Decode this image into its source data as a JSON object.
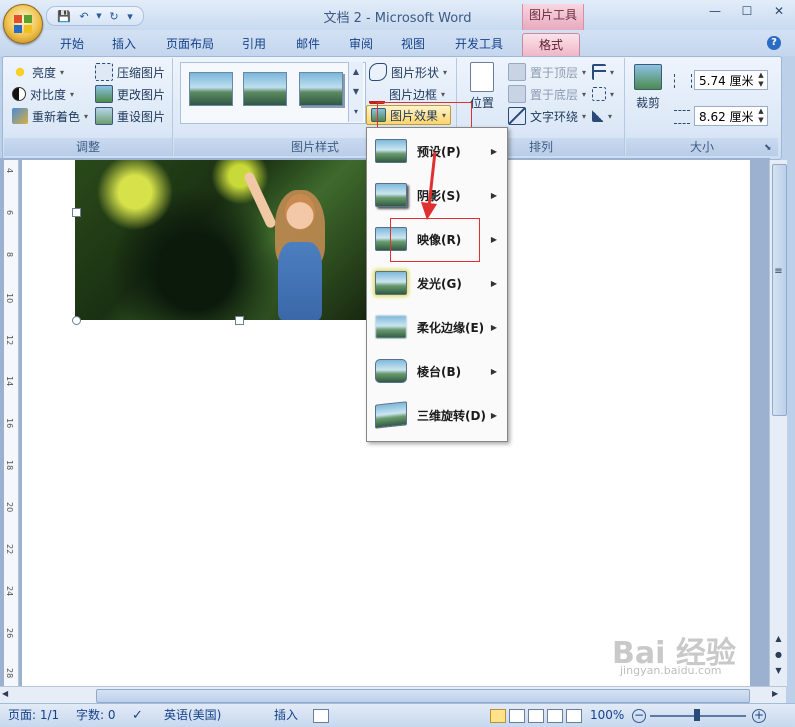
{
  "window": {
    "doc_title": "文档 2 - Microsoft Word",
    "context_tab_title": "图片工具",
    "controls": [
      "—",
      "☐",
      "✕"
    ]
  },
  "tabs": [
    "开始",
    "插入",
    "页面布局",
    "引用",
    "邮件",
    "审阅",
    "视图",
    "开发工具",
    "格式"
  ],
  "active_tab": "格式",
  "ribbon": {
    "adjust": {
      "label": "调整",
      "brightness": "亮度",
      "contrast": "对比度",
      "recolor": "重新着色",
      "compress": "压缩图片",
      "change": "更改图片",
      "reset": "重设图片"
    },
    "styles": {
      "label": "图片样式",
      "shape": "图片形状",
      "border": "图片边框",
      "effects": "图片效果"
    },
    "arrange": {
      "label": "排列",
      "position": "位置",
      "bring_front": "置于顶层",
      "send_back": "置于底层",
      "wrap": "文字环绕"
    },
    "size": {
      "label": "大小",
      "crop": "裁剪",
      "height": "5.74 厘米",
      "width": "8.62 厘米"
    }
  },
  "effects_menu": [
    {
      "label": "预设(P)"
    },
    {
      "label": "阴影(S)"
    },
    {
      "label": "映像(R)"
    },
    {
      "label": "发光(G)"
    },
    {
      "label": "柔化边缘(E)"
    },
    {
      "label": "棱台(B)"
    },
    {
      "label": "三维旋转(D)"
    }
  ],
  "ruler_marks": [
    "4",
    "6",
    "8",
    "10",
    "12",
    "14",
    "16",
    "18",
    "20",
    "22",
    "24",
    "26",
    "28"
  ],
  "status": {
    "page": "页面: 1/1",
    "words": "字数: 0",
    "language": "英语(美国)",
    "mode": "插入",
    "zoom": "100%"
  },
  "watermark": {
    "logo": "Bai 经验",
    "url": "jingyan.baidu.com"
  }
}
